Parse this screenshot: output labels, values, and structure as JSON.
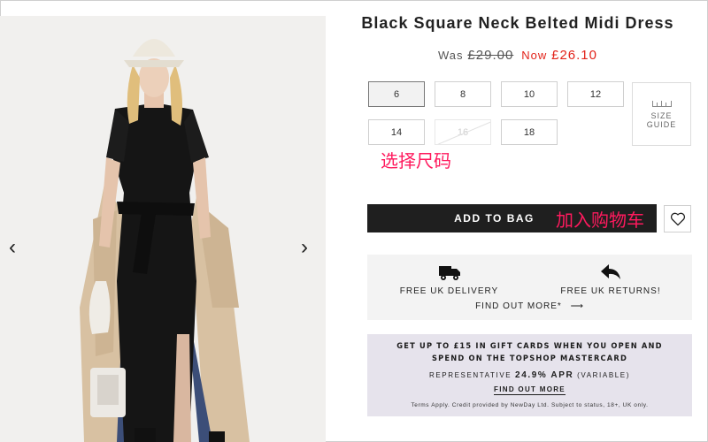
{
  "product": {
    "title": "Black Square Neck Belted Midi Dress",
    "was_label": "Was",
    "was_price": "£29.00",
    "now_label": "Now",
    "now_price": "£26.10"
  },
  "gallery": {
    "prev_icon": "chevron-left-icon",
    "next_icon": "chevron-right-icon",
    "prev_glyph": "‹",
    "next_glyph": "›"
  },
  "sizes": [
    {
      "label": "6",
      "state": "selected"
    },
    {
      "label": "8",
      "state": "available"
    },
    {
      "label": "10",
      "state": "available"
    },
    {
      "label": "12",
      "state": "available"
    },
    {
      "label": "14",
      "state": "available"
    },
    {
      "label": "16",
      "state": "unavailable"
    },
    {
      "label": "18",
      "state": "available"
    }
  ],
  "size_guide": {
    "line1": "SIZE",
    "line2": "GUIDE"
  },
  "annotations": {
    "choose_size": "选择尺码",
    "add_to_cart": "加入购物车"
  },
  "actions": {
    "add_to_bag": "ADD TO BAG",
    "wishlist_icon": "heart-icon"
  },
  "delivery": {
    "free_delivery": "FREE UK DELIVERY",
    "free_returns": "FREE UK RETURNS!",
    "find_out_more": "FIND OUT MORE*",
    "arrow": "⟶"
  },
  "promo": {
    "line1": "GET UP TO £15 IN GIFT CARDS WHEN YOU OPEN AND",
    "line2": "SPEND ON THE TOPSHOP MASTERCARD",
    "rep_prefix": "REPRESENTATIVE",
    "apr": "24.9% APR",
    "rep_suffix": "(VARIABLE)",
    "find_out_more": "FIND OUT MORE",
    "terms": "Terms Apply. Credit provided by NewDay Ltd. Subject to status, 18+, UK only."
  },
  "colors": {
    "sale_red": "#e2231a",
    "annotation_pink": "#ff1a5e",
    "button_black": "#1f1f1f",
    "promo_bg": "#e6e3ec"
  }
}
